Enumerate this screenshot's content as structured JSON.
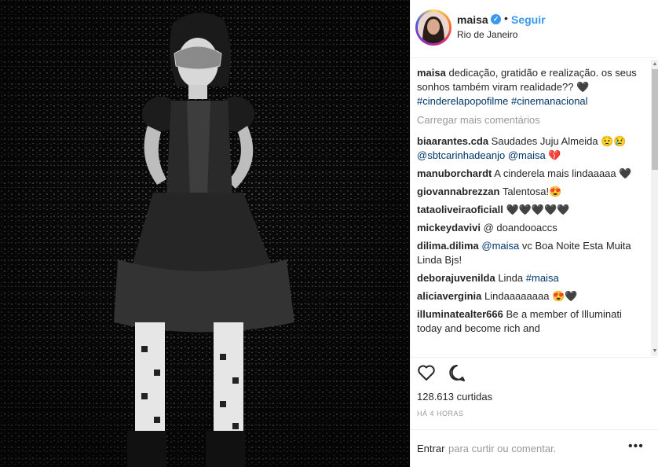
{
  "post": {
    "username": "maisa",
    "follow_label": "Seguir",
    "separator": "•",
    "location": "Rio de Janeiro",
    "verified_icon": "check-icon"
  },
  "caption": {
    "username": "maisa",
    "text": "dedicação, gratidão e realização. os seus sonhos também viram realidade?? 🖤",
    "tag1": "#cinderelapopofilme",
    "tag2": "#cinemanacional"
  },
  "load_more": "Carregar mais comentários",
  "comments": [
    {
      "user": "biaarantes.cda",
      "text": "Saudades Juju Almeida 😟😢",
      "mention1": "@sbtcarinhadeanjo",
      "mention2": "@maisa",
      "after": "💔"
    },
    {
      "user": "manuborchardt",
      "text": "A cinderela mais lindaaaaa 🖤"
    },
    {
      "user": "giovannabrezzan",
      "text": "Talentosa!😍"
    },
    {
      "user": "tataoliveiraoficiall",
      "text": "🖤🖤🖤🖤🖤"
    },
    {
      "user": "mickeydavivi",
      "text": "@ doandooaccs"
    },
    {
      "user": "dilima.dilima",
      "mention": "@maisa",
      "text": "vc Boa Noite Esta Muita Linda Bjs!"
    },
    {
      "user": "deborajuvenilda",
      "text": "Linda",
      "mention": "#maisa"
    },
    {
      "user": "aliciaverginia",
      "text": "Lindaaaaaaaa 😍🖤"
    },
    {
      "user": "illuminatealter666",
      "text": "Be a member of Illuminati today and become rich and"
    }
  ],
  "likes": "128.613 curtidas",
  "timestamp": "HÁ 4 HORAS",
  "add_comment": {
    "login": "Entrar",
    "hint": "para curtir ou comentar.",
    "options": "•••"
  }
}
